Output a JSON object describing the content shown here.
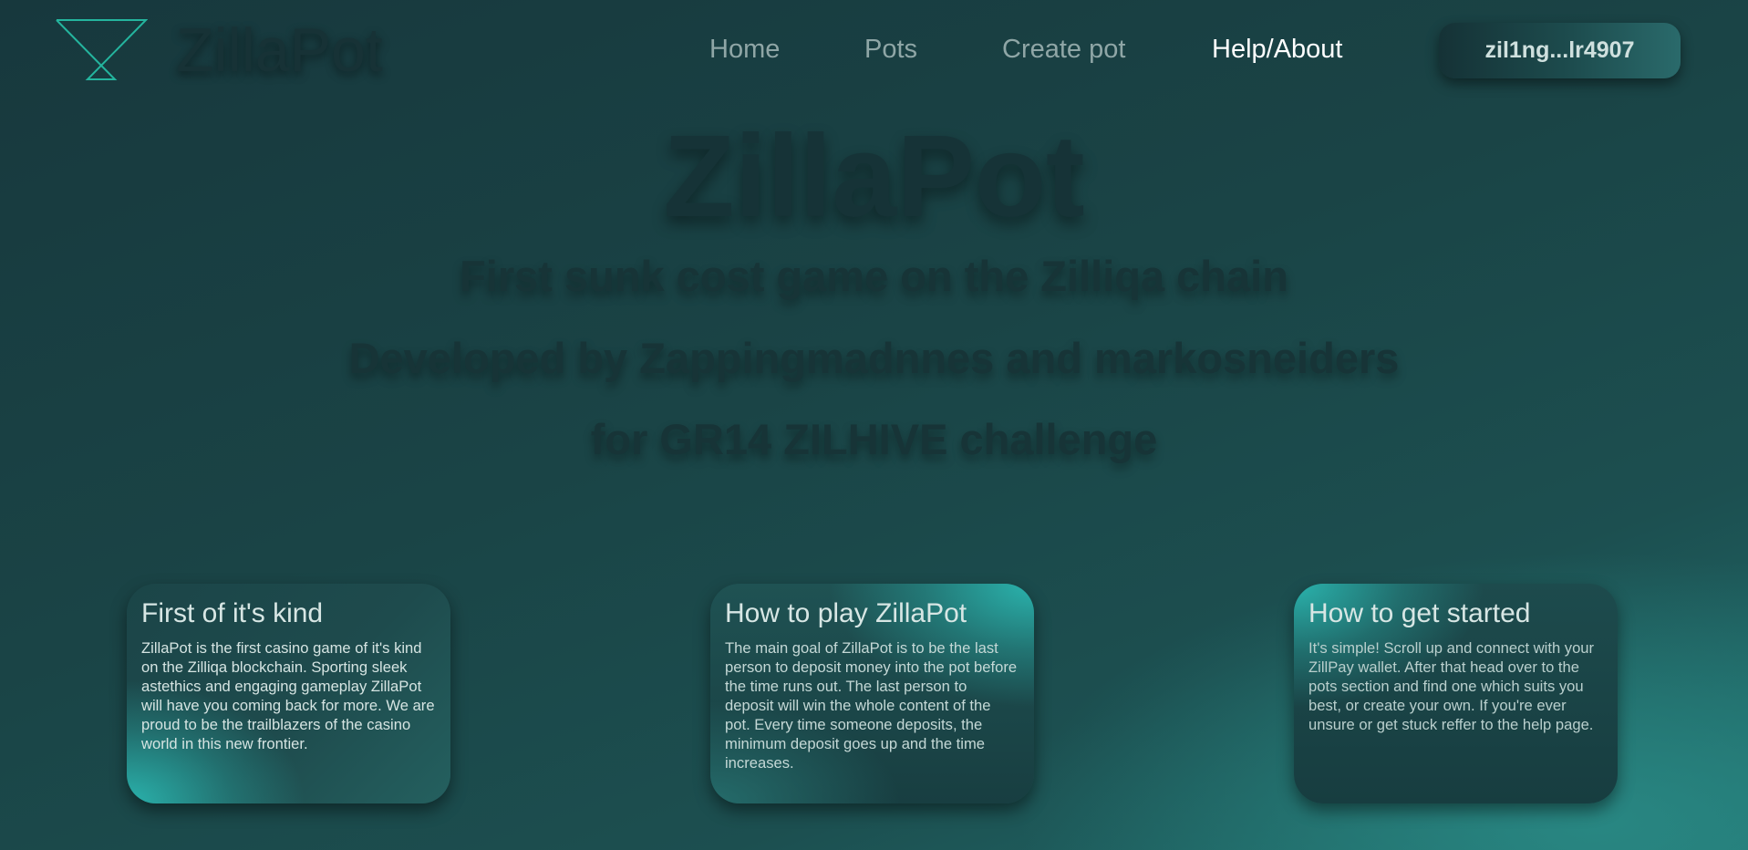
{
  "header": {
    "brand": "ZillaPot",
    "nav": [
      {
        "label": "Home"
      },
      {
        "label": "Pots"
      },
      {
        "label": "Create pot"
      },
      {
        "label": "Help/About"
      }
    ],
    "wallet_address": "zil1ng...lr4907"
  },
  "hero": {
    "title": "ZillaPot",
    "lines": [
      "First sunk cost game on the Zilliqa chain",
      "Developed by Zappingmadnnes and markosneiders",
      "for GR14 ZILHIVE challenge"
    ]
  },
  "cards": [
    {
      "title": "First of it's kind",
      "body": "ZillaPot is the first casino game of it's kind on the Zilliqa blockchain. Sporting sleek astethics and engaging gameplay ZillaPot will have you coming back for more. We are proud to be the trailblazers of the casino world in this new frontier."
    },
    {
      "title": "How to play ZillaPot",
      "body": "The main goal of ZillaPot is to be the last person to deposit money into the pot before the time runs out. The last person to deposit will win the whole content of the pot. Every time someone deposits, the minimum deposit goes up and the time increases."
    },
    {
      "title": "How to get started",
      "body": "It's simple! Scroll up and connect with your ZillPay wallet. After that head over to the pots section and find one which suits you best, or create your own. If you're ever unsure or get stuck reffer to the help page."
    }
  ],
  "colors": {
    "accent": "#2ab3ad",
    "logo": "#24b59e",
    "background": "#1a4446",
    "nav_text": "#8fa6a6",
    "nav_active": "#ffffff"
  },
  "icons": {
    "logo": "hourglass-logo-icon"
  }
}
